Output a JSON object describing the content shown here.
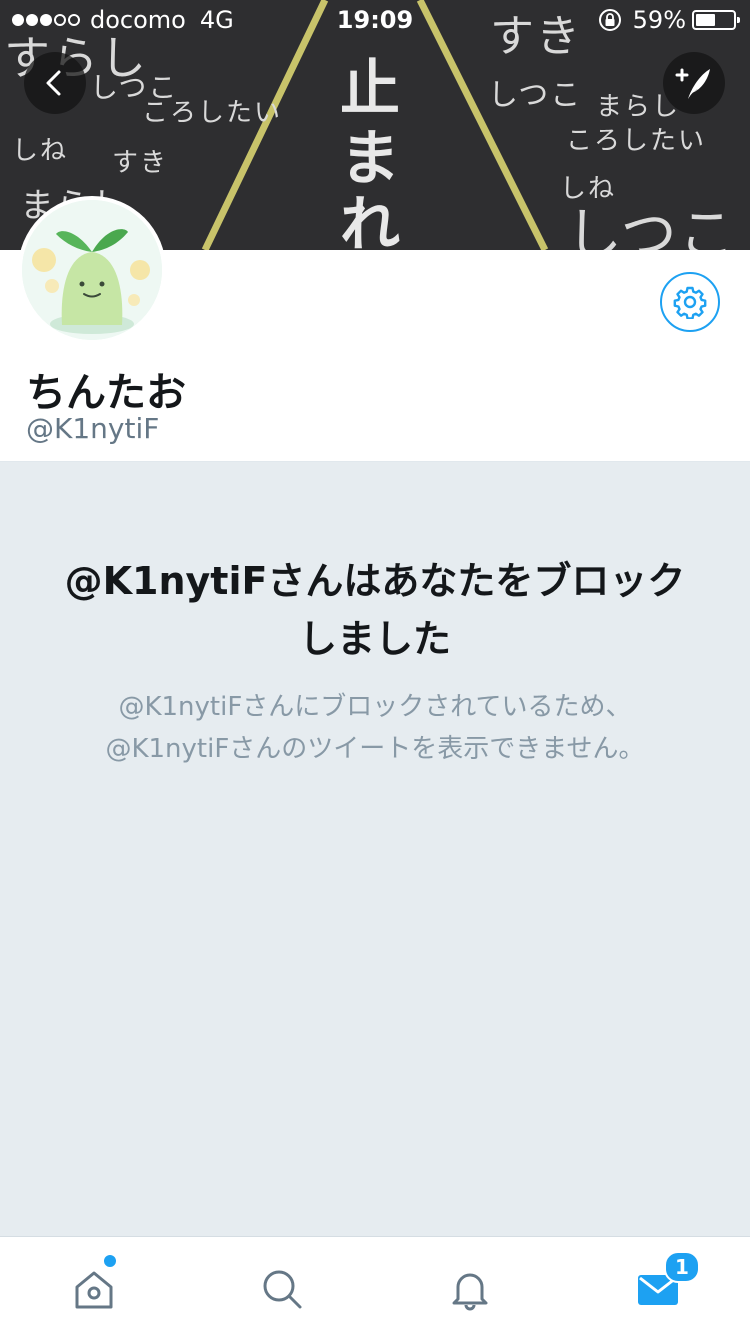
{
  "status_bar": {
    "carrier": "docomo",
    "network": "4G",
    "time": "19:09",
    "battery": "59%",
    "battery_level": 0.59
  },
  "banner": {
    "sign_text": [
      "止",
      "ま",
      "れ"
    ],
    "scribbles": [
      "すらし",
      "しつこ",
      "ころしたい",
      "しね",
      "すき",
      "まらし",
      "すき",
      "しつこ",
      "まらし",
      "ころしたい",
      "しね",
      "しつこ"
    ]
  },
  "profile": {
    "display_name": "ちんたお",
    "screen_name": "@K1nytiF"
  },
  "blocked": {
    "title": "@K1nytiFさんはあなたをブロックしました",
    "line1": "@K1nytiFさんにブロックされているため、",
    "line2": "@K1nytiFさんのツイートを表示できません。"
  },
  "tabbar": {
    "messages_badge": "1"
  },
  "colors": {
    "accent": "#1da1f2",
    "background": "#e6ecf0",
    "muted": "#8899a6"
  },
  "icons": [
    "back-arrow-icon",
    "compose-tweet-icon",
    "gear-icon",
    "home-icon",
    "search-icon",
    "notifications-bell-icon",
    "mail-icon",
    "lock-rotation-icon"
  ]
}
